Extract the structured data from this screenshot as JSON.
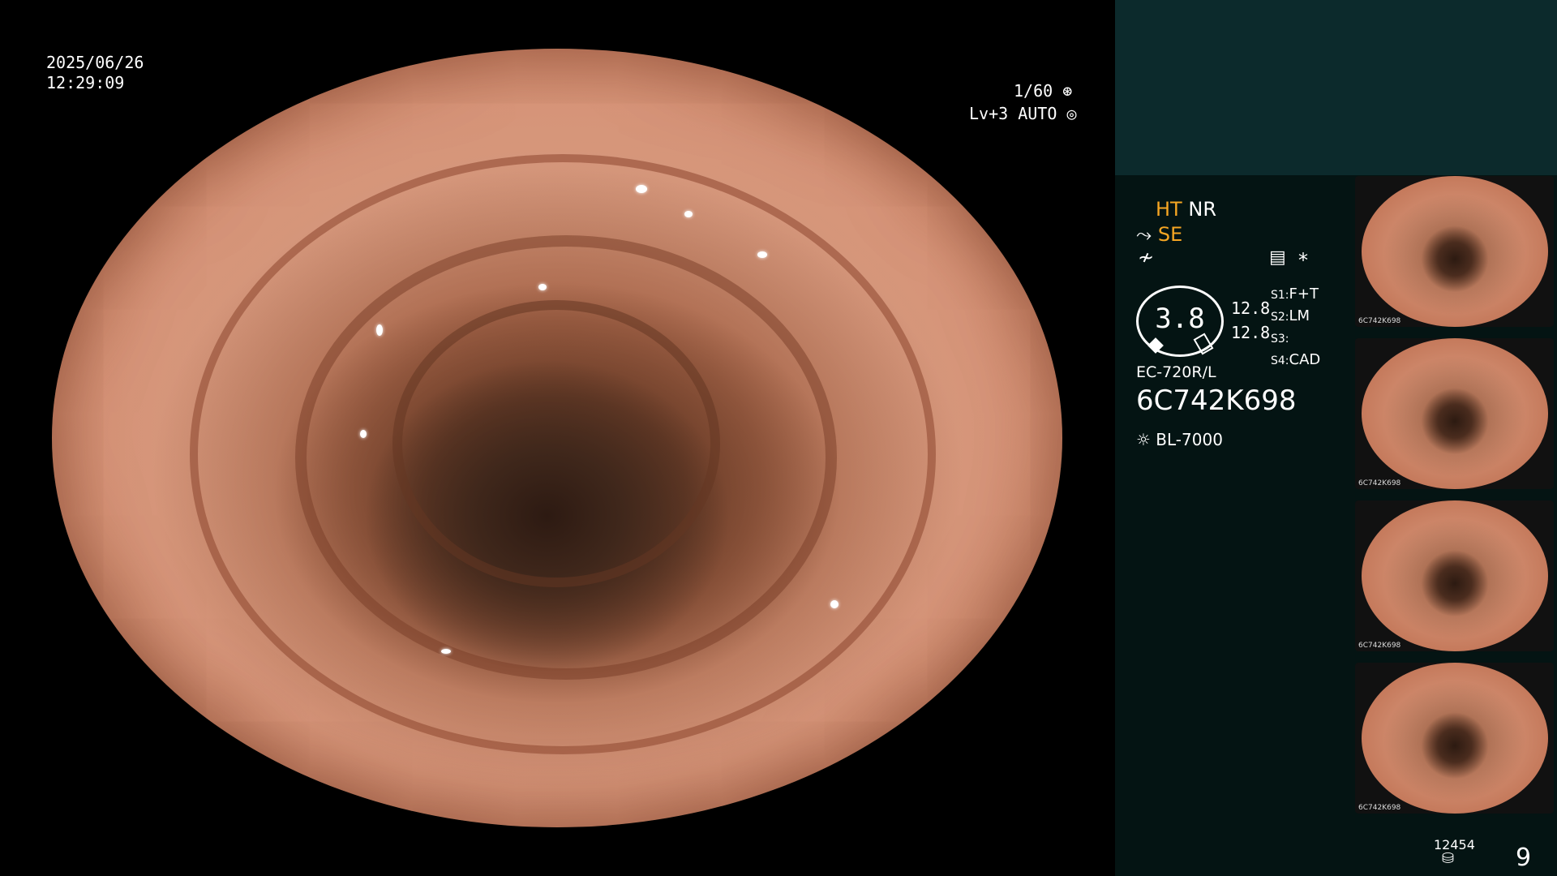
{
  "overlay": {
    "date": "2025/06/26",
    "time": "12:29:09",
    "shutter": "1/60",
    "level": "Lv+3",
    "mode": "AUTO"
  },
  "panel": {
    "ht": "HT",
    "nr": "NR",
    "se": "SE",
    "asterisk": "*",
    "dial_value": "3.8",
    "value_a": "12.8",
    "value_b": "12.8",
    "settings": [
      {
        "key": "S1:",
        "value": "F+T"
      },
      {
        "key": "S2:",
        "value": "LM"
      },
      {
        "key": "S3:",
        "value": ""
      },
      {
        "key": "S4:",
        "value": "CAD"
      }
    ],
    "scope_model": "EC-720R/L",
    "serial": "6C742K698",
    "light_source": "BL-7000",
    "thumb_serial": "6C742K698",
    "storage_count": "12454",
    "page": "9"
  },
  "colors": {
    "accent": "#f6a623",
    "panel_bg": "#041413",
    "panel_top": "#0c2a2c"
  },
  "icons": [
    "shutter-icon",
    "auto-iris-icon",
    "scope-icon",
    "tilde-icon",
    "memo-icon",
    "light-source-icon",
    "storage-icon"
  ]
}
